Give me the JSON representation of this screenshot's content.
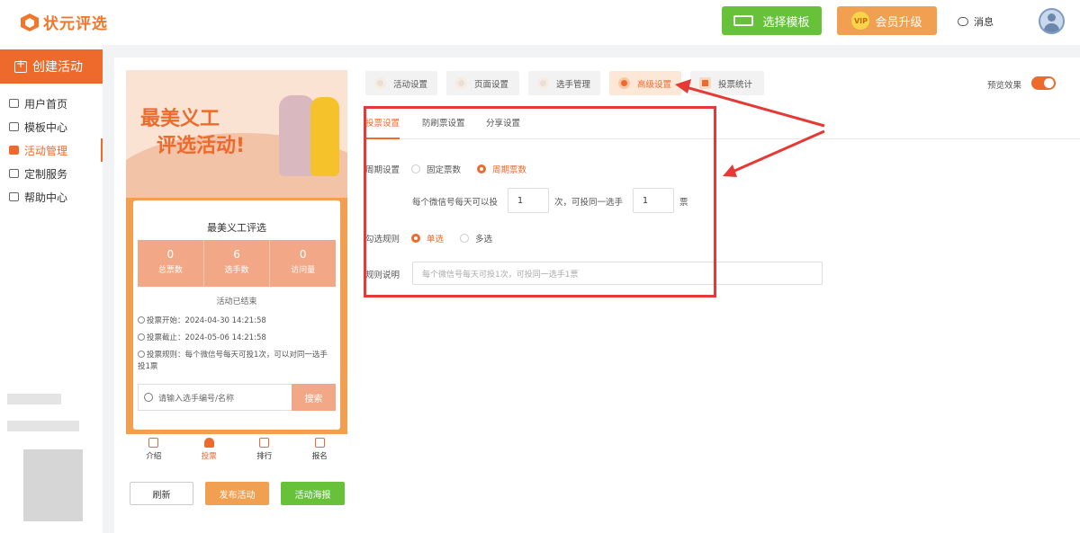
{
  "header": {
    "logo_text": "状元评选",
    "template_button": "选择模板",
    "vip_badge": "VIP",
    "vip_button": "会员升级",
    "messages": "消息",
    "brand_color": "#ee6a2c",
    "green_color": "#67c23a"
  },
  "sidebar": {
    "create_button": "创建活动",
    "items": [
      {
        "label": "用户首页",
        "icon": "home-icon"
      },
      {
        "label": "模板中心",
        "icon": "template-icon"
      },
      {
        "label": "活动管理",
        "icon": "ticket-icon",
        "active": true
      },
      {
        "label": "定制服务",
        "icon": "custom-icon"
      },
      {
        "label": "帮助中心",
        "icon": "help-icon"
      }
    ]
  },
  "phone": {
    "banner_line1": "最美义工",
    "banner_line2": "评选活动!",
    "card_title": "最美义工评选",
    "stats": [
      {
        "value": "0",
        "label": "总票数"
      },
      {
        "value": "6",
        "label": "选手数"
      },
      {
        "value": "0",
        "label": "访问量"
      }
    ],
    "status": "活动已结束",
    "vote_start": "投票开始：2024-04-30 14:21:58",
    "vote_end": "投票截止：2024-05-06 14:21:58",
    "vote_rule": "投票规则：每个微信号每天可投1次，可以对同一选手投1票",
    "search_placeholder": "请输入选手编号/名称",
    "search_button": "搜索",
    "tabs": [
      "介绍",
      "投票",
      "排行",
      "报名"
    ]
  },
  "bottom_buttons": {
    "refresh": "刷新",
    "publish": "发布活动",
    "poster": "活动海报"
  },
  "settings": {
    "tabs": [
      "活动设置",
      "页面设置",
      "选手管理",
      "高级设置",
      "投票统计"
    ],
    "active_tab": "高级设置",
    "preview_label": "预览效果",
    "preview_on": true,
    "subtabs": [
      "投票设置",
      "防刷票设置",
      "分享设置"
    ],
    "cycle_label": "周期设置",
    "cycle_options": [
      "固定票数",
      "周期票数"
    ],
    "cycle_selected": "周期票数",
    "per_day_prefix": "每个微信号每天可以投",
    "per_day_value": "1",
    "per_day_mid": "次，可投同一选手",
    "same_player_value": "1",
    "per_day_suffix": "票",
    "select_rule_label": "勾选规则",
    "select_options": [
      "单选",
      "多选"
    ],
    "select_selected": "单选",
    "rule_desc_label": "规则说明",
    "rule_desc_placeholder": "每个微信号每天可投1次，可投同一选手1票"
  }
}
